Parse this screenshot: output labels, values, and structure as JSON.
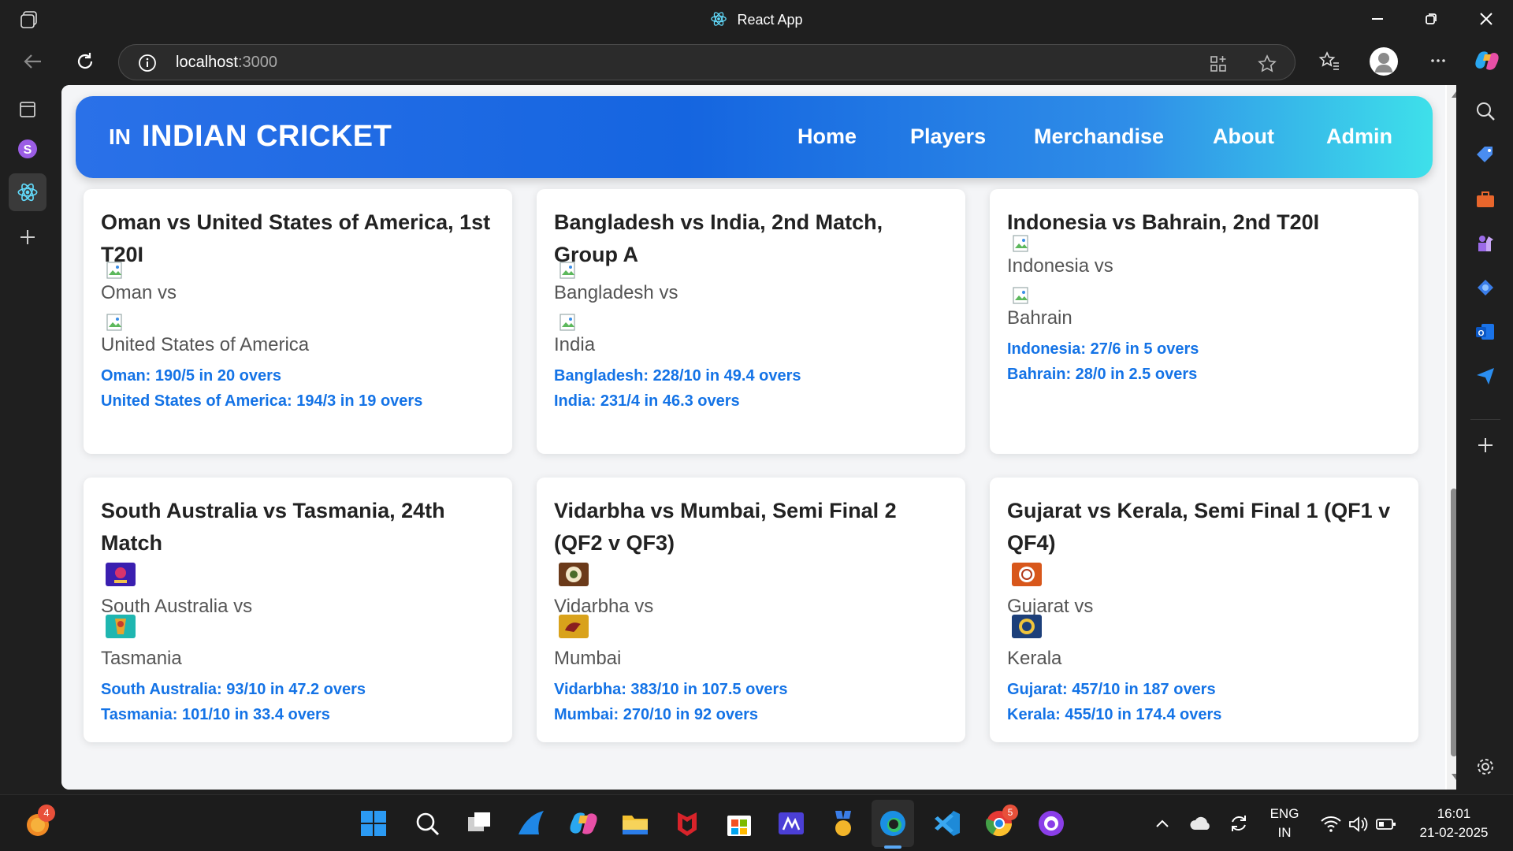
{
  "window": {
    "title": "React App",
    "icons": [
      "tab-actions-icon",
      "react-icon",
      "minimize-icon",
      "restore-icon",
      "close-icon"
    ]
  },
  "addressbar": {
    "url_host": "localhost",
    "url_port": ":3000"
  },
  "site": {
    "brand_flag": "IN",
    "brand_name": "INDIAN CRICKET",
    "nav": [
      "Home",
      "Players",
      "Merchandise",
      "About",
      "Admin"
    ]
  },
  "matches": [
    {
      "title": "Oman vs United States of America, 1st T20I",
      "team1": "Oman vs",
      "team2": "United States of America",
      "score1": "Oman: 190/5 in 20 overs",
      "score2": "United States of America: 194/3 in 19 overs",
      "logos": "broken"
    },
    {
      "title": "Bangladesh vs India, 2nd Match, Group A",
      "team1": "Bangladesh vs",
      "team2": "India",
      "score1": "Bangladesh: 228/10 in 49.4 overs",
      "score2": "India: 231/4 in 46.3 overs",
      "logos": "broken"
    },
    {
      "title": "Indonesia vs Bahrain, 2nd T20I",
      "team1": "Indonesia vs",
      "team2": "Bahrain",
      "score1": "Indonesia: 27/6 in 5 overs",
      "score2": "Bahrain: 28/0 in 2.5 overs",
      "logos": "broken"
    },
    {
      "title": "South Australia vs Tasmania, 24th Match",
      "team1": "South Australia vs",
      "team2": "Tasmania",
      "score1": "South Australia: 93/10 in 47.2 overs",
      "score2": "Tasmania: 101/10 in 33.4 overs",
      "logos": "image"
    },
    {
      "title": "Vidarbha vs Mumbai, Semi Final 2 (QF2 v QF3)",
      "team1": "Vidarbha vs",
      "team2": "Mumbai",
      "score1": "Vidarbha: 383/10 in 107.5 overs",
      "score2": "Mumbai: 270/10 in 92 overs",
      "logos": "image"
    },
    {
      "title": "Gujarat vs Kerala, Semi Final 1 (QF1 v QF4)",
      "team1": "Gujarat vs",
      "team2": "Kerala",
      "score1": "Gujarat: 457/10 in 187 overs",
      "score2": "Kerala: 455/10 in 174.4 overs",
      "logos": "image"
    }
  ],
  "taskbar": {
    "notification_badge": "4",
    "chrome_badge": "5",
    "lang_top": "ENG",
    "lang_bottom": "IN",
    "time": "16:01",
    "date": "21-02-2025"
  },
  "colors": {
    "accent": "#1473e6",
    "header_start": "#2a71e8",
    "header_end": "#3ee0ea",
    "chrome_bg": "#1f1f1f"
  }
}
